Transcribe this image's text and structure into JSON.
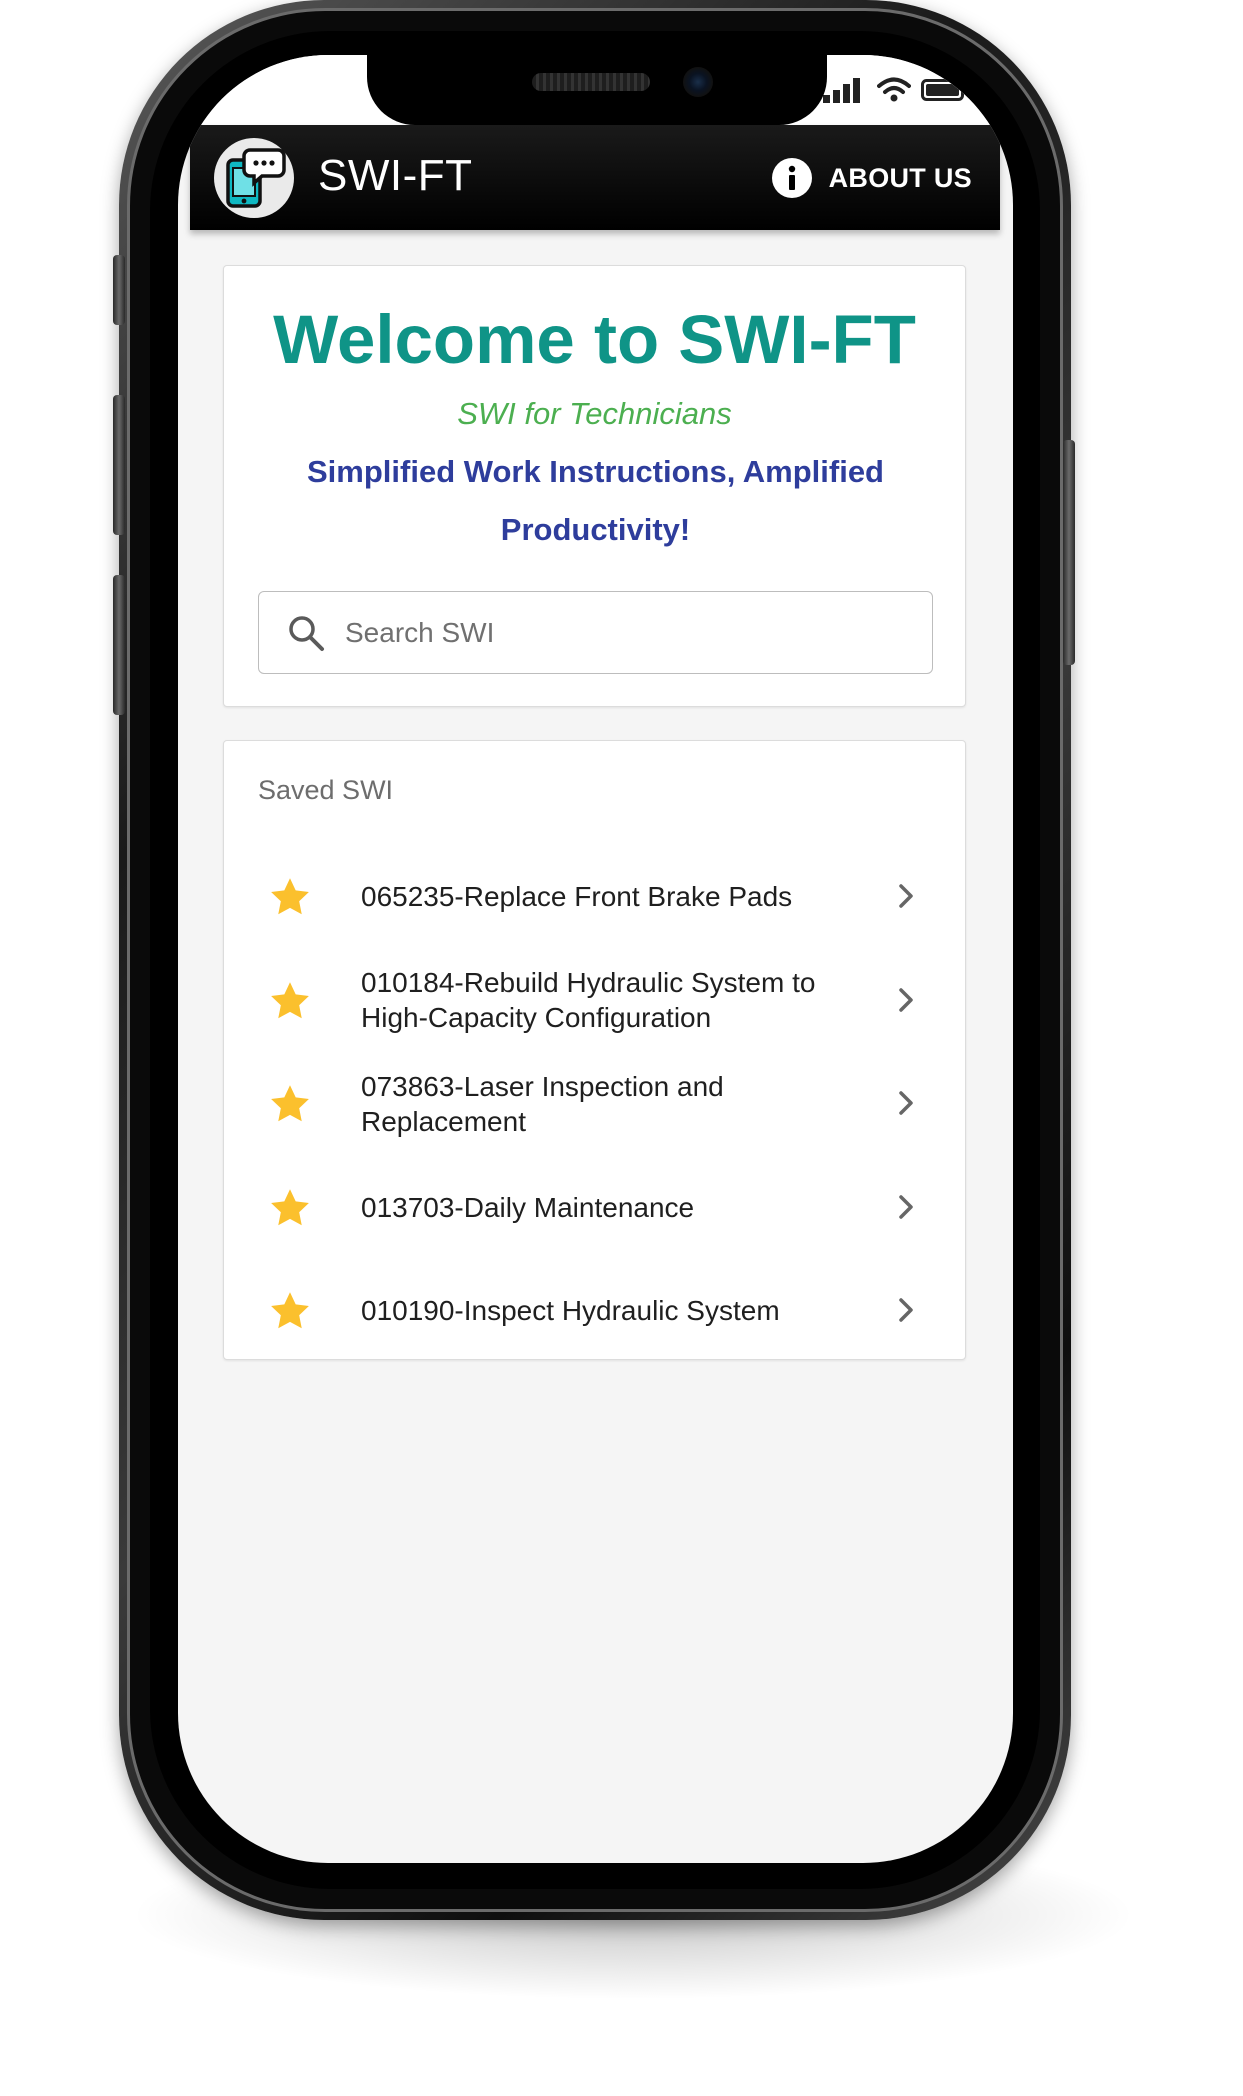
{
  "app": {
    "title": "SWI-FT",
    "about_label": "ABOUT US"
  },
  "welcome": {
    "title": "Welcome to SWI-FT",
    "subtitle": "SWI for Technicians",
    "tagline": "Simplified Work Instructions, Amplified Productivity!"
  },
  "search": {
    "placeholder": "Search SWI",
    "value": ""
  },
  "saved": {
    "header": "Saved SWI",
    "items": [
      {
        "label": "065235-Replace Front Brake Pads",
        "starred": true
      },
      {
        "label": "010184-Rebuild Hydraulic System to High-Capacity Configuration",
        "starred": true
      },
      {
        "label": "073863-Laser Inspection and Replacement",
        "starred": true
      },
      {
        "label": "013703-Daily Maintenance",
        "starred": true
      },
      {
        "label": "010190-Inspect Hydraulic System",
        "starred": true
      }
    ]
  },
  "colors": {
    "accent_teal": "#0f9487",
    "subtitle_green": "#4caf50",
    "tagline_blue": "#2e3d9c",
    "star_yellow": "#fbc02d",
    "app_bar": "#000000"
  },
  "icons": {
    "logo": "phone-chat-logo",
    "about": "info-icon",
    "search": "search-icon",
    "star": "star-icon",
    "chevron": "chevron-right-icon"
  }
}
